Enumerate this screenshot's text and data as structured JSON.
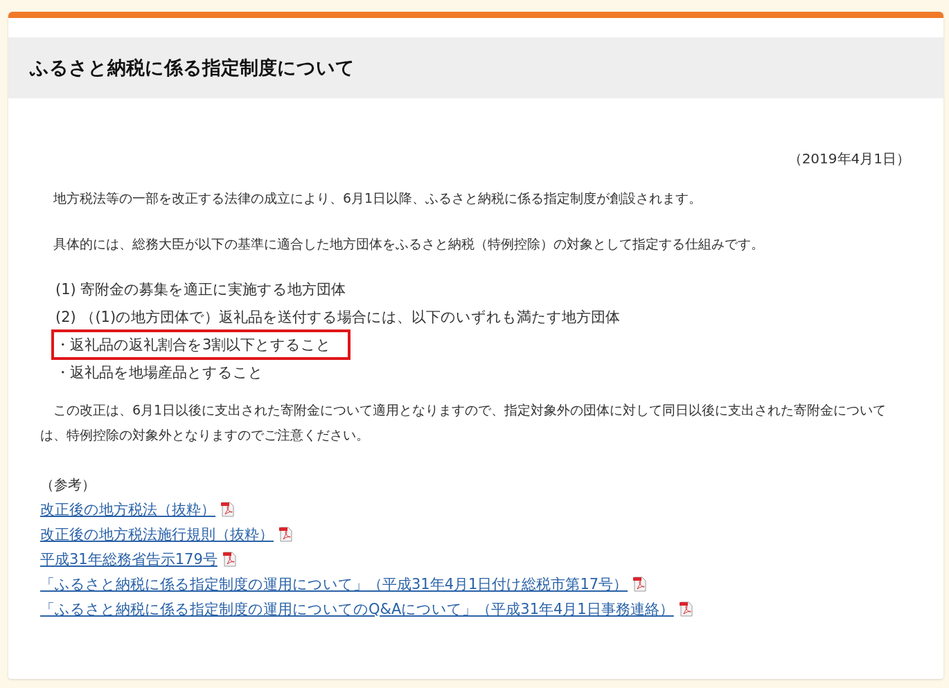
{
  "header": {
    "title": "ふるさと納税に係る指定制度について"
  },
  "date": "（2019年4月1日）",
  "intro": [
    "地方税法等の一部を改正する法律の成立により、6月1日以降、ふるさと納税に係る指定制度が創設されます。",
    "具体的には、総務大臣が以下の基準に適合した地方団体をふるさと納税（特例控除）の対象として指定する仕組みです。"
  ],
  "criteria": [
    {
      "text": "(1) 寄附金の募集を適正に実施する地方団体",
      "highlighted": false
    },
    {
      "text": "(2) （(1)の地方団体で）返礼品を送付する場合には、以下のいずれも満たす地方団体",
      "highlighted": false
    },
    {
      "text": "・返礼品の返礼割合を3割以下とすること",
      "highlighted": true
    },
    {
      "text": "・返礼品を地場産品とすること",
      "highlighted": false
    }
  ],
  "note": "この改正は、6月1日以後に支出された寄附金について適用となりますので、指定対象外の団体に対して同日以後に支出された寄附金については、特例控除の対象外となりますのでご注意ください。",
  "reference_label": "（参考）",
  "links": [
    {
      "text": "改正後の地方税法（抜粋）"
    },
    {
      "text": "改正後の地方税法施行規則（抜粋）"
    },
    {
      "text": "平成31年総務省告示179号"
    },
    {
      "text": "「ふるさと納税に係る指定制度の運用について」（平成31年4月1日付け総税市第17号）"
    },
    {
      "text": "「ふるさと納税に係る指定制度の運用についてのQ&Aについて」（平成31年4月1日事務連絡）"
    }
  ]
}
